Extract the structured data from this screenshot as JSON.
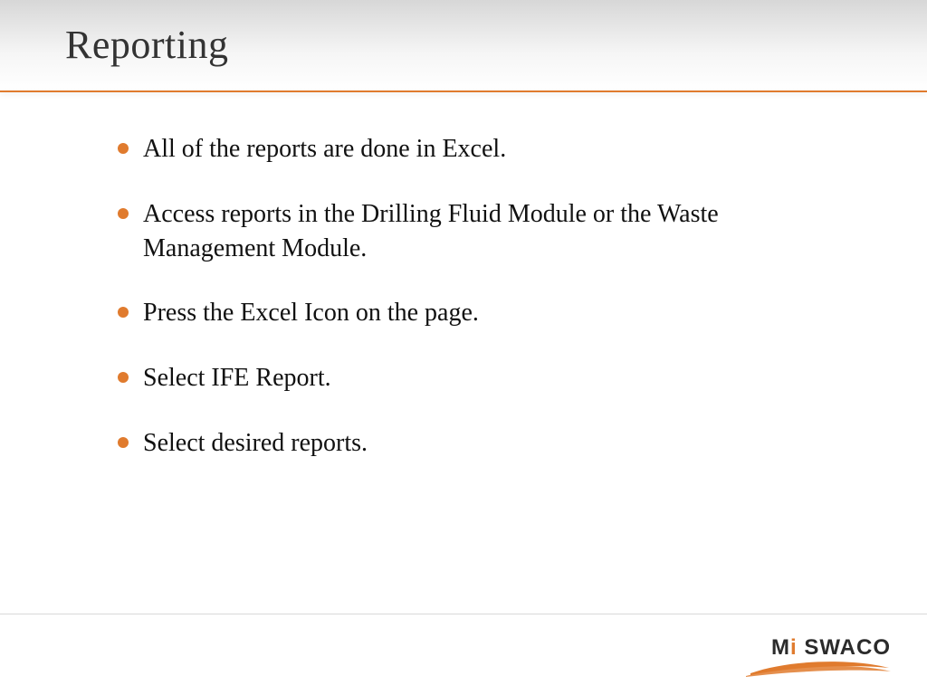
{
  "title": "Reporting",
  "bullets": [
    "All of the reports are done in Excel.",
    "Access reports in the Drilling Fluid Module or the Waste Management Module.",
    "Press the Excel Icon on the page.",
    "Select IFE Report.",
    "Select desired reports."
  ],
  "logo": {
    "prefix": "M",
    "accent": "i",
    "suffix": " SWACO"
  },
  "colors": {
    "accent": "#e07b2e"
  }
}
